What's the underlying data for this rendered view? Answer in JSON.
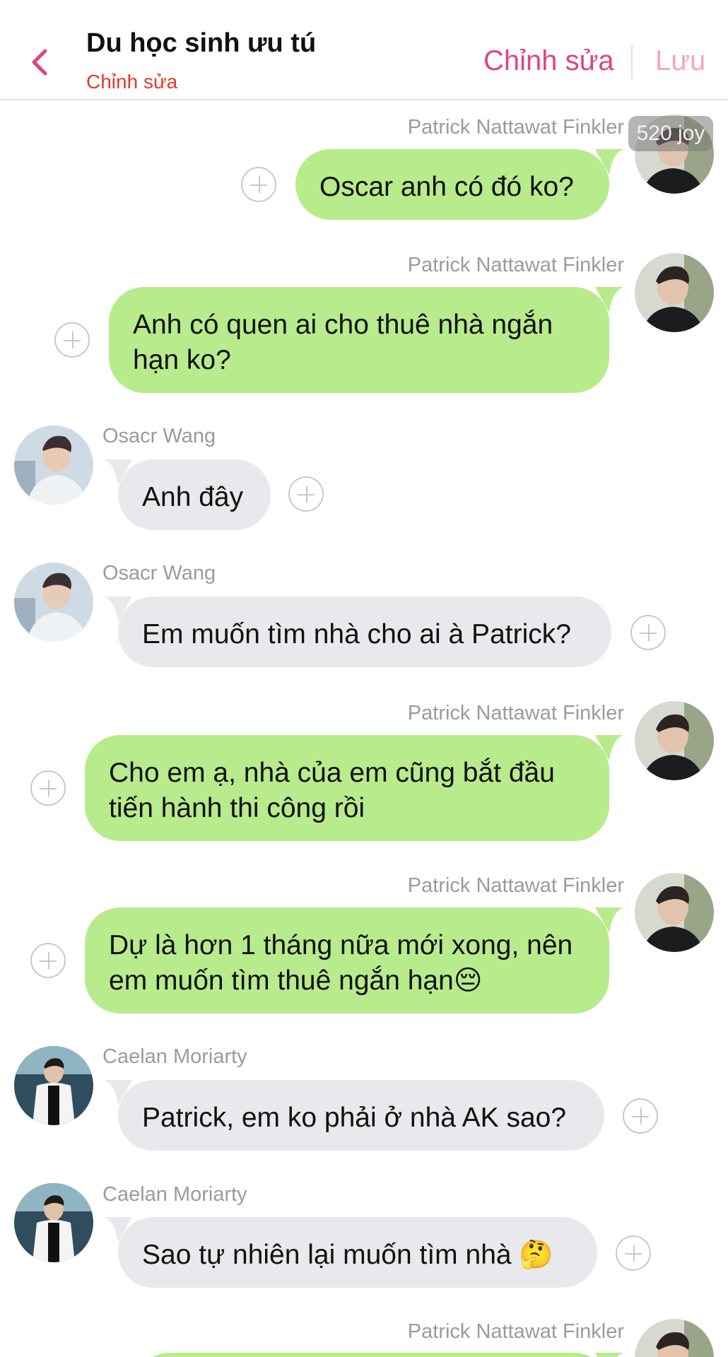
{
  "header": {
    "title": "Du học sinh ưu tú",
    "subtitle": "Chỉnh sửa",
    "edit_label": "Chỉnh sửa",
    "save_label": "Lưu"
  },
  "badge": "520 joy",
  "colors": {
    "accent": "#e0457f",
    "subtitle": "#e23b2a",
    "bubble_green": "#b8eb8c",
    "bubble_gray": "#e7e9ec"
  },
  "messages": [
    {
      "sender": "Patrick Nattawat Finkler",
      "side": "right",
      "text": "Oscar anh có đó ko?"
    },
    {
      "sender": "Patrick Nattawat Finkler",
      "side": "right",
      "text": "Anh có quen ai cho thuê nhà ngắn hạn ko?"
    },
    {
      "sender": "Osacr Wang",
      "side": "left",
      "text": "Anh đây"
    },
    {
      "sender": "Osacr Wang",
      "side": "left",
      "text": "Em muốn tìm nhà cho ai à Patrick?"
    },
    {
      "sender": "Patrick Nattawat Finkler",
      "side": "right",
      "text": "Cho em ạ, nhà của em cũng bắt đầu tiến hành thi công rồi"
    },
    {
      "sender": "Patrick Nattawat Finkler",
      "side": "right",
      "text": "Dự là hơn 1 tháng nữa mới xong, nên em muốn tìm thuê ngắn hạn😔"
    },
    {
      "sender": "Caelan Moriarty",
      "side": "left",
      "text": "Patrick, em ko phải ở nhà AK sao?"
    },
    {
      "sender": "Caelan Moriarty",
      "side": "left",
      "text": "Sao tự nhiên lại muốn tìm nhà 🤔"
    },
    {
      "sender": "Patrick Nattawat Finkler",
      "side": "right",
      "text": ""
    }
  ]
}
